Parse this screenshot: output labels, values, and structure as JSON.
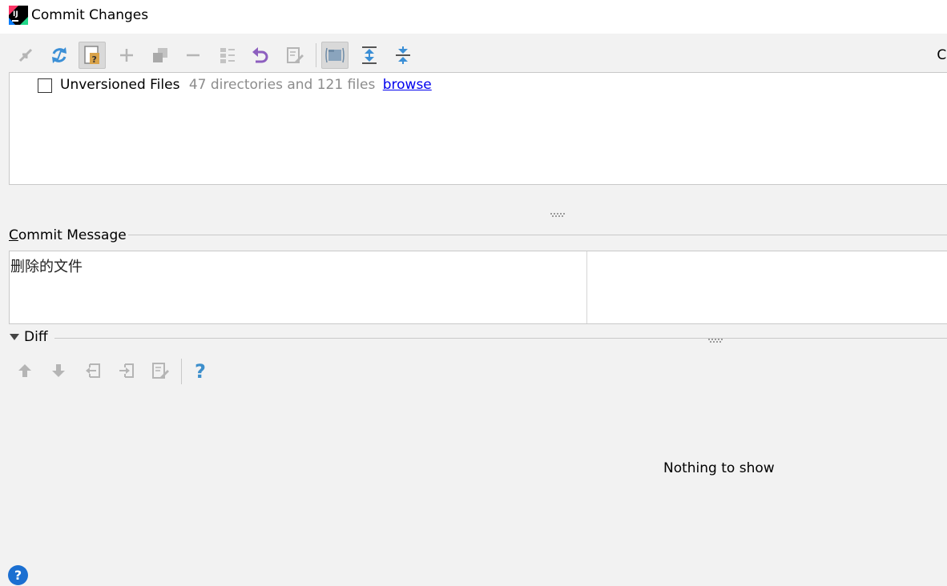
{
  "window": {
    "title": "Commit Changes",
    "right_edge_text": "Cl"
  },
  "changes": {
    "unversioned_label": "Unversioned Files",
    "unversioned_count": "47 directories and 121 files",
    "browse_link": "browse"
  },
  "commit_message": {
    "label_first": "C",
    "label_rest": "ommit Message",
    "value": "删除的文件"
  },
  "diff": {
    "label": "Diff",
    "empty_text": "Nothing to show"
  },
  "help": {
    "label": "?"
  },
  "icons": {
    "toolbar": [
      "move-changes-icon",
      "refresh-icon",
      "unversioned-files-icon",
      "add-icon",
      "copy-icon",
      "remove-icon",
      "group-by-icon",
      "rollback-icon",
      "edit-source-icon",
      "show-diff-icon",
      "expand-all-icon",
      "collapse-all-icon"
    ],
    "diff_toolbar": [
      "prev-diff-icon",
      "next-diff-icon",
      "prev-file-icon",
      "next-file-icon",
      "edit-source-icon",
      "help-icon"
    ]
  },
  "colors": {
    "link": "#0000ee",
    "muted": "#8c8c8c",
    "rollback": "#8d5fbf",
    "refresh": "#3b8fd6",
    "help": "#3d8fcc"
  }
}
